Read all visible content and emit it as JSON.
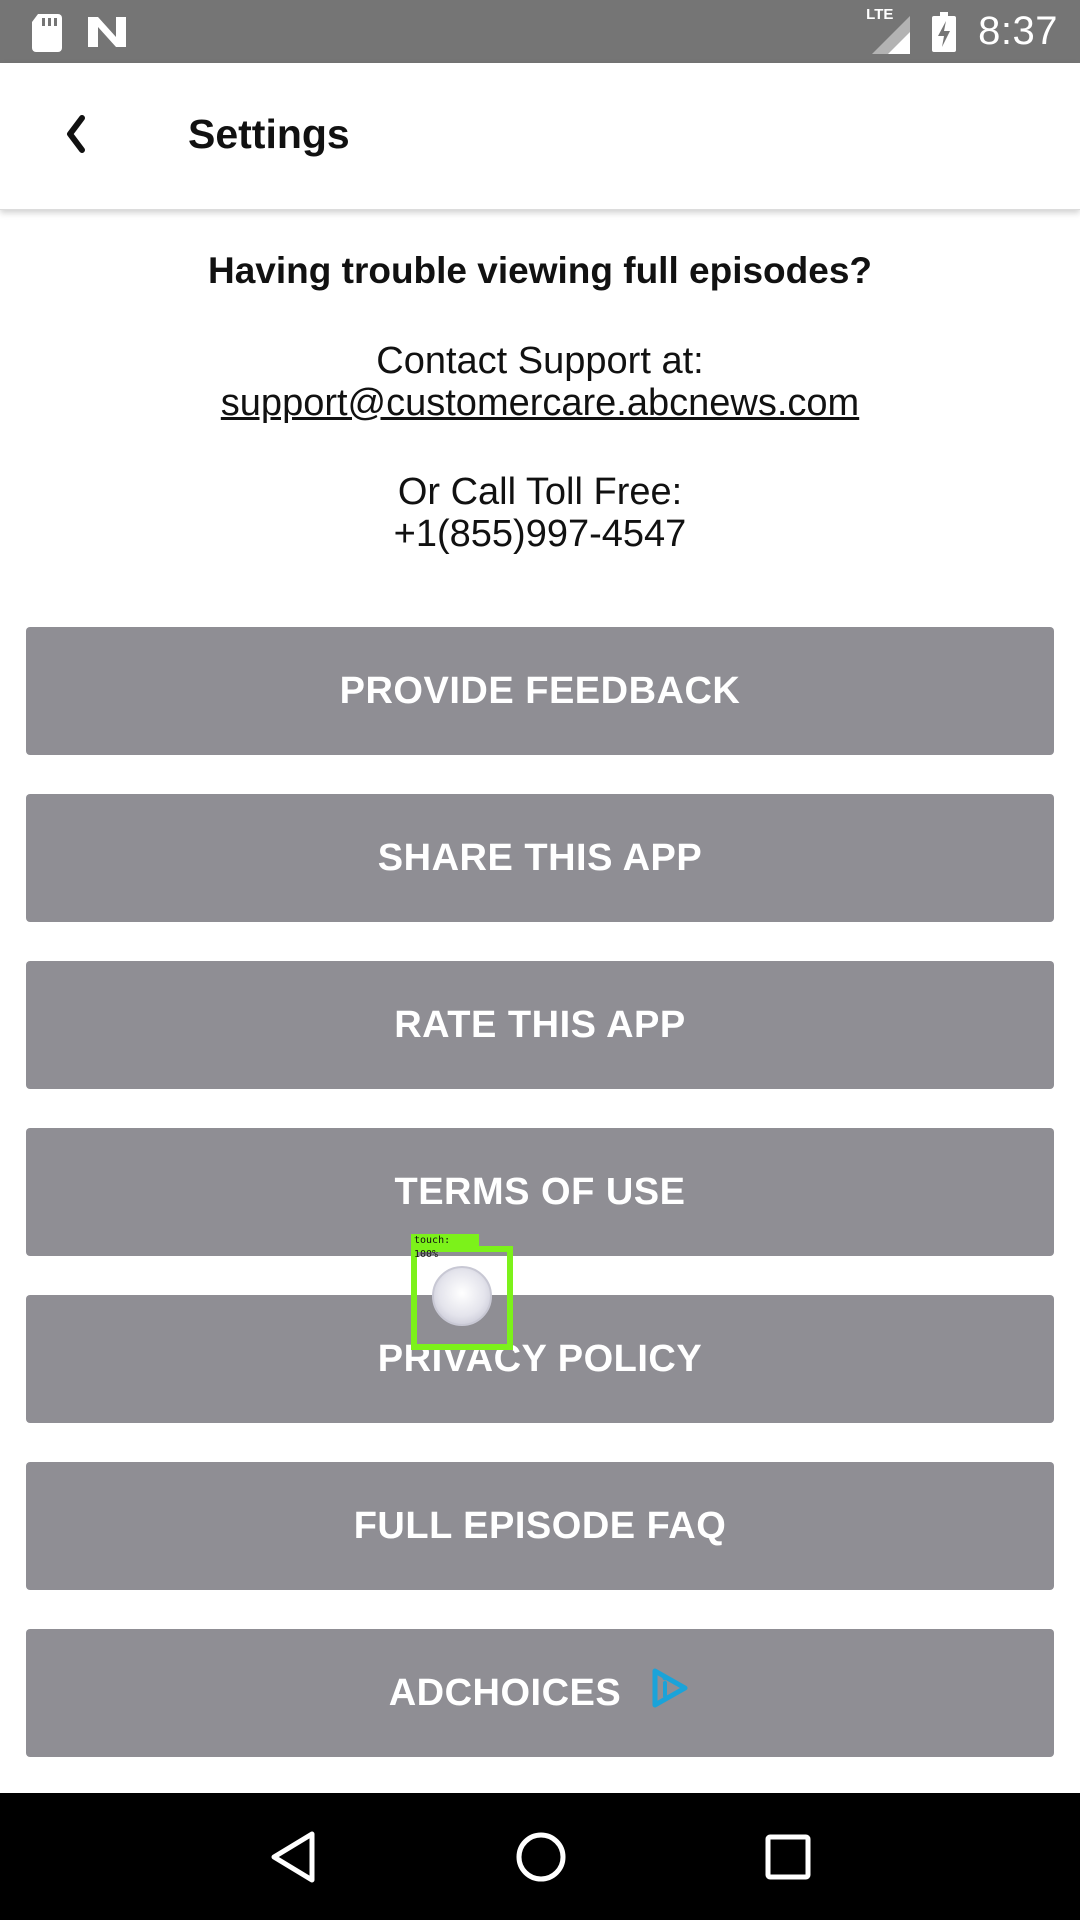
{
  "status_bar": {
    "time": "8:37",
    "network": "LTE",
    "icons": [
      "sd-card-icon",
      "n-logo-icon",
      "signal-icon",
      "battery-charging-icon"
    ]
  },
  "header": {
    "title": "Settings",
    "back_icon": "chevron-left-icon"
  },
  "support": {
    "heading": "Having trouble viewing full episodes?",
    "contact_label": "Contact Support at:",
    "email": "support@customercare.abcnews.com",
    "call_label": "Or Call Toll Free:",
    "phone": "+1(855)997-4547"
  },
  "buttons": [
    {
      "label": "PROVIDE FEEDBACK"
    },
    {
      "label": "SHARE THIS APP"
    },
    {
      "label": "RATE THIS APP"
    },
    {
      "label": "TERMS OF USE"
    },
    {
      "label": "PRIVACY POLICY"
    },
    {
      "label": "FULL EPISODE FAQ"
    },
    {
      "label": "ADCHOICES",
      "icon": "adchoices-icon"
    }
  ],
  "touch_indicator": {
    "label": "touch: 100%"
  },
  "nav": {
    "icons": [
      "back-triangle-icon",
      "home-circle-icon",
      "recents-square-icon"
    ]
  },
  "colors": {
    "status_bar": "#757575",
    "button_bg": "#8f8e94",
    "adchoices_accent": "#1aa3d9",
    "touch_highlight": "#7cf21a"
  }
}
